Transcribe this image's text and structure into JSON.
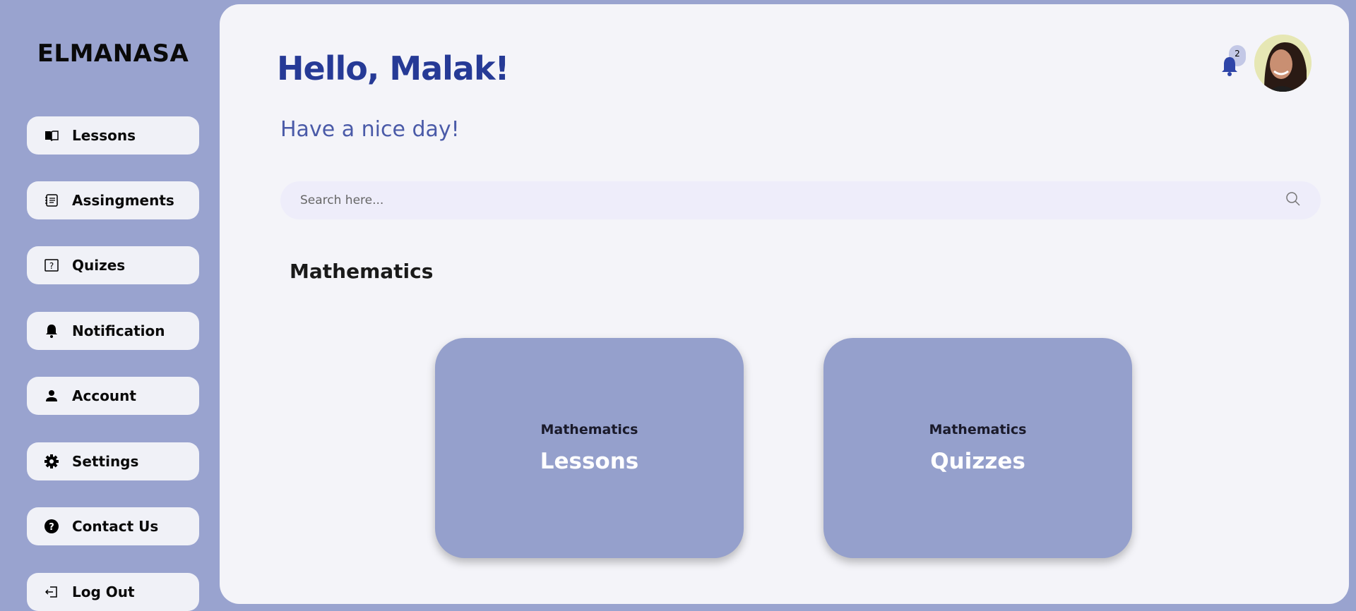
{
  "sidebar": {
    "brand": "ELMANASA",
    "items": [
      {
        "label": "Lessons",
        "icon": "book-icon"
      },
      {
        "label": "Assingments",
        "icon": "assignment-icon"
      },
      {
        "label": "Quizes",
        "icon": "question-box-icon"
      },
      {
        "label": "Notification",
        "icon": "bell-icon"
      },
      {
        "label": "Account",
        "icon": "user-icon"
      },
      {
        "label": "Settings",
        "icon": "gear-icon"
      },
      {
        "label": "Contact Us",
        "icon": "help-circle-icon"
      },
      {
        "label": "Log Out",
        "icon": "logout-icon"
      }
    ]
  },
  "header": {
    "greeting": "Hello, Malak!",
    "subtitle": "Have a nice day!",
    "notification_count": "2"
  },
  "search": {
    "placeholder": "Search here..."
  },
  "main": {
    "section_title": "Mathematics",
    "cards": [
      {
        "subject": "Mathematics",
        "title": "Lessons"
      },
      {
        "subject": "Mathematics",
        "title": "Quizzes"
      }
    ]
  },
  "colors": {
    "sidebar": "#99a3cf",
    "accent": "#263a96",
    "card": "#95a0cc"
  }
}
